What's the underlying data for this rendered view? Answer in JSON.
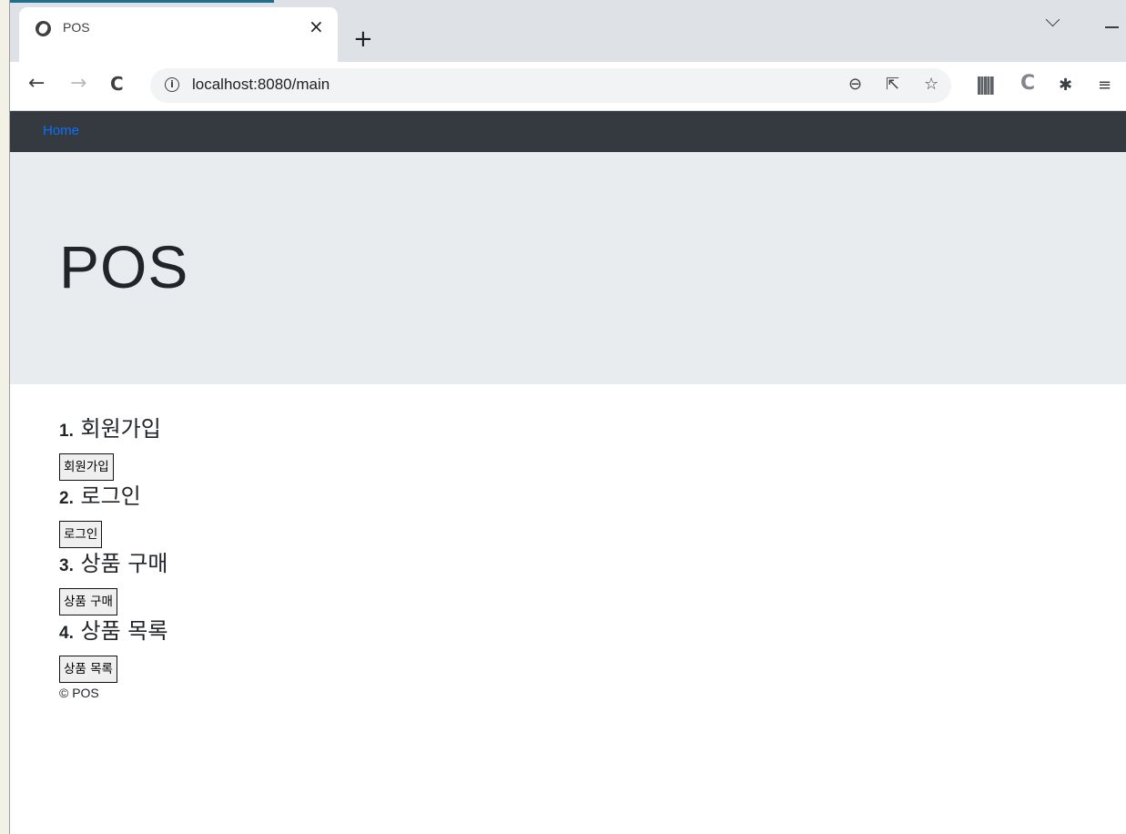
{
  "browser": {
    "tab": {
      "title": "POS",
      "close_glyph": "×"
    },
    "new_tab_glyph": "+",
    "address_bar": {
      "url": "localhost:8080/main"
    },
    "icons": {
      "back": "←",
      "forward": "→",
      "reload": "C",
      "info": "i",
      "zoom": "⊖",
      "share": "⇱",
      "bookmark": "☆",
      "extension_c": "C",
      "puzzle": "✱",
      "playlist": "≡"
    }
  },
  "navbar": {
    "home_label": "Home"
  },
  "jumbotron": {
    "title": "POS"
  },
  "sections": [
    {
      "number": "1.",
      "title": "회원가입",
      "button": "회원가입"
    },
    {
      "number": "2.",
      "title": "로그인",
      "button": "로그인"
    },
    {
      "number": "3.",
      "title": "상품 구매",
      "button": "상품 구매"
    },
    {
      "number": "4.",
      "title": "상품 목록",
      "button": "상품 목록"
    }
  ],
  "footer": {
    "text": "© POS"
  },
  "colors": {
    "navbar_bg": "#343a40",
    "link_blue": "#0d6efd",
    "jumbotron_bg": "#e9ecef",
    "tabstrip_bg": "#dee1e6"
  }
}
